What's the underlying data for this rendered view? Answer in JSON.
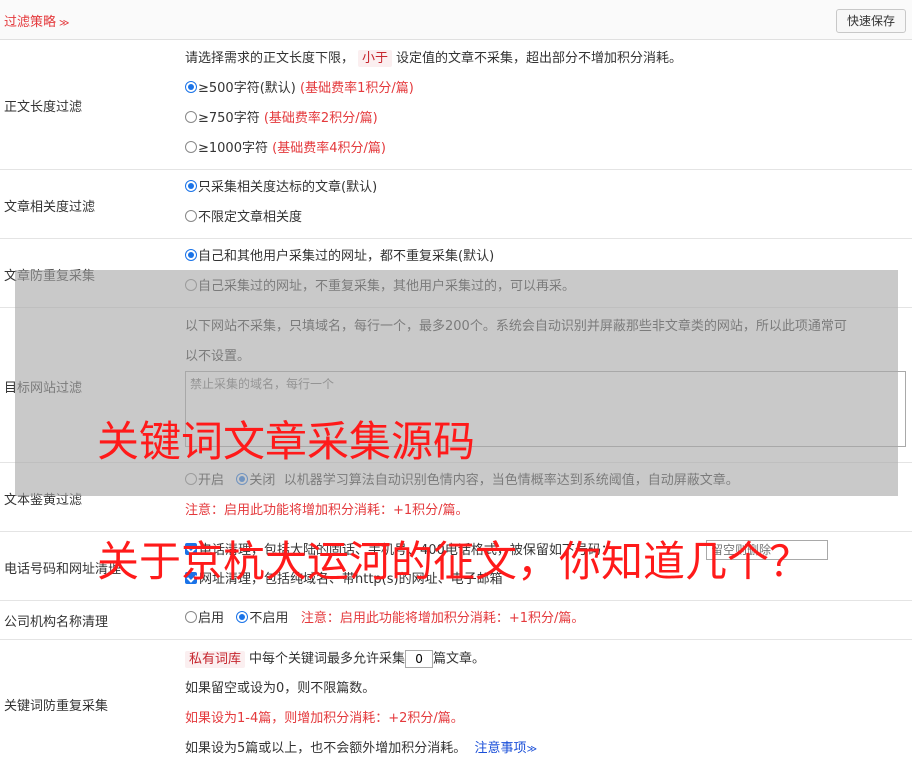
{
  "header": {
    "title": "过滤策略",
    "save_label": "快速保存"
  },
  "length": {
    "label": "正文长度过滤",
    "desc_before": "请选择需求的正文长度下限，",
    "desc_tag": "小于",
    "desc_after": "设定值的文章不采集，超出部分不增加积分消耗。",
    "options": [
      {
        "label": "≥500字符(默认)",
        "note": "(基础费率1积分/篇)",
        "checked": true
      },
      {
        "label": "≥750字符",
        "note": "(基础费率2积分/篇)",
        "checked": false
      },
      {
        "label": "≥1000字符",
        "note": "(基础费率4积分/篇)",
        "checked": false
      }
    ]
  },
  "relevance": {
    "label": "文章相关度过滤",
    "options": [
      {
        "label": "只采集相关度达标的文章(默认)",
        "checked": true
      },
      {
        "label": "不限定文章相关度",
        "checked": false
      }
    ]
  },
  "dedupe": {
    "label": "文章防重复采集",
    "options": [
      {
        "label": "自己和其他用户采集过的网址，都不重复采集(默认)",
        "checked": true
      },
      {
        "label": "自己采集过的网址，不重复采集，其他用户采集过的，可以再采。",
        "checked": false
      }
    ]
  },
  "site": {
    "label": "目标网站过滤",
    "desc1": "以下网站不采集，只填域名，每行一个，最多200个。系统会自动识别并屏蔽那些非文章类的网站，所以此项通常可",
    "desc2": "以不设置。",
    "placeholder": "禁止采集的域名，每行一个"
  },
  "porn": {
    "label": "文本鉴黄过滤",
    "on_label": "开启",
    "off_label": "关闭",
    "desc": "以机器学习算法自动识别色情内容，当色情概率达到系统阈值，自动屏蔽文章。",
    "note": "注意：启用此功能将增加积分消耗：+1积分/篇。"
  },
  "phone": {
    "label": "电话号码和网址清理",
    "phone_opt": "电话清理，包括大陆的固话、手机号、400电话格式，被保留如下号码：",
    "phone_placeholder": "留空则删除",
    "url_opt": "网址清理，包括纯域名、带http(s)的网址、电子邮箱"
  },
  "company": {
    "label": "公司机构名称清理",
    "on_label": "启用",
    "off_label": "不启用",
    "note": "注意：启用此功能将增加积分消耗：+1积分/篇。"
  },
  "keyword": {
    "label": "关键词防重复采集",
    "tag": "私有词库",
    "line1_before": "中每个关键词最多允许采集",
    "value": "0",
    "line1_after": "篇文章。",
    "line2": "如果留空或设为0，则不限篇数。",
    "line3": "如果设为1-4篇，则增加积分消耗：+2积分/篇。",
    "line4": "如果设为5篇或以上，也不会额外增加积分消耗。",
    "link": "注意事项"
  },
  "watermark": {
    "line1": "关键词文章采集源码",
    "line2": "关于京杭大运河的征文，你知道几个？"
  }
}
